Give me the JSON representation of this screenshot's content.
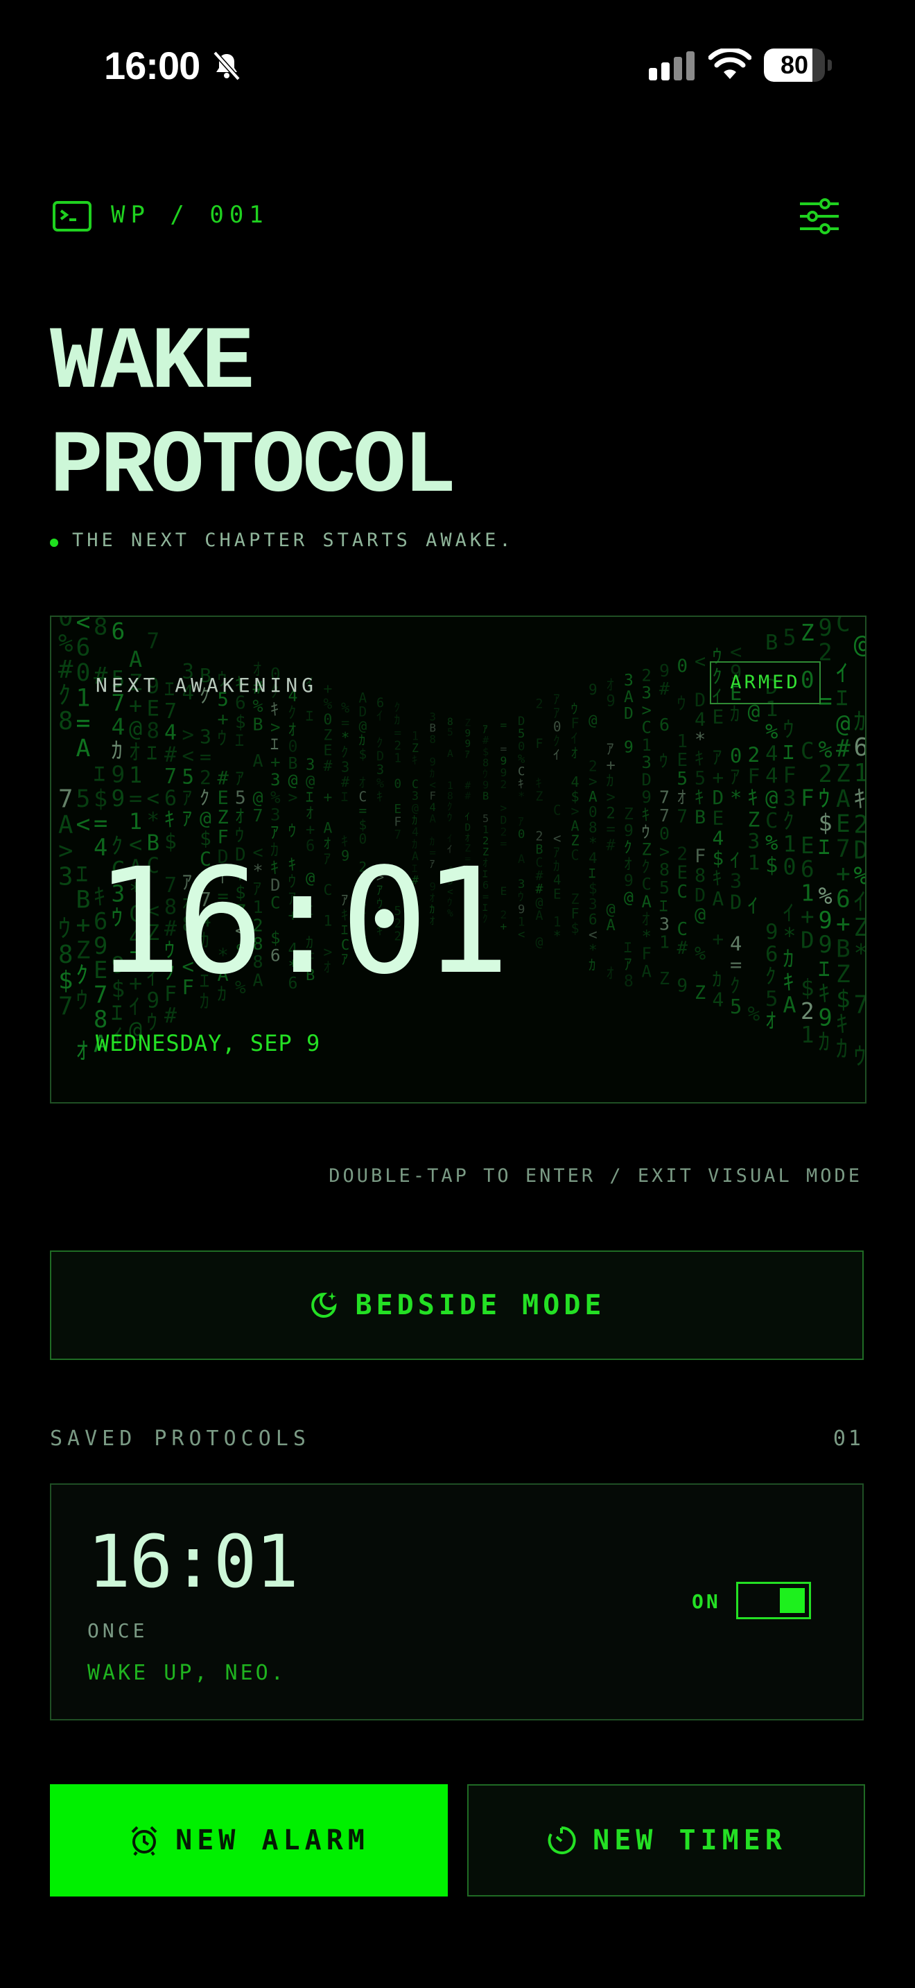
{
  "status_bar": {
    "time": "16:00",
    "battery": "80",
    "battery_level": 0.8
  },
  "header": {
    "brand": "WP / 001",
    "title_line1": "WAKE",
    "title_line2": "PROTOCOL",
    "tagline": "THE NEXT CHAPTER STARTS AWAKE."
  },
  "hero": {
    "label": "NEXT AWAKENING",
    "badge": "ARMED",
    "time": "16:01",
    "date": "WEDNESDAY, SEP 9"
  },
  "hint": "DOUBLE-TAP TO ENTER / EXIT VISUAL MODE",
  "bedside": {
    "label": "BEDSIDE MODE"
  },
  "saved": {
    "label": "SAVED PROTOCOLS",
    "count": "01",
    "alarms": [
      {
        "time": "16:01",
        "repeat": "ONCE",
        "note": "WAKE UP, NEO.",
        "state_label": "ON",
        "enabled": true
      }
    ]
  },
  "actions": {
    "new_alarm": "NEW ALARM",
    "new_timer": "NEW TIMER"
  },
  "colors": {
    "accent": "#00f000",
    "text": "#cdf7d8",
    "muted": "#7a9a84",
    "background": "#000000"
  }
}
